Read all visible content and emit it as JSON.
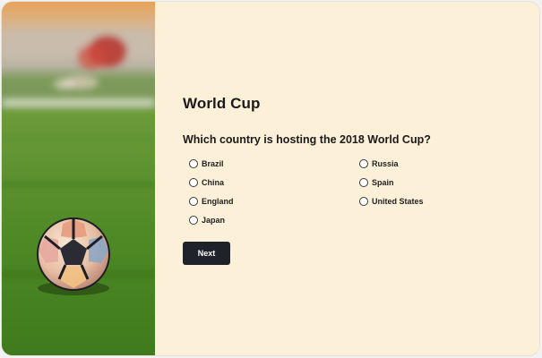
{
  "survey": {
    "title": "World Cup",
    "question": "Which country is hosting the 2018 World Cup?",
    "options_left": [
      "Brazil",
      "China",
      "England",
      "Japan"
    ],
    "options_right": [
      "Russia",
      "Spain",
      "United States"
    ],
    "next_label": "Next"
  },
  "colors": {
    "background": "#fdf0d8",
    "button": "#1f2329",
    "grass": "#4f8a2a"
  }
}
